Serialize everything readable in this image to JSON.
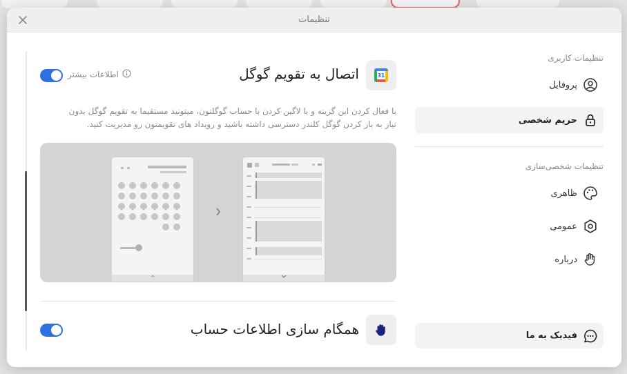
{
  "modal": {
    "title": "تنظیمات"
  },
  "sidebar": {
    "user_settings_title": "تنظیمات کاربری",
    "items": [
      {
        "label": "پروفایل",
        "icon": "user-circle-icon"
      },
      {
        "label": "حریم شخصی",
        "icon": "lock-icon",
        "active": true
      }
    ],
    "personalization_title": "تنظیمات شخصی‌سازی",
    "personal_items": [
      {
        "label": "ظاهری",
        "icon": "palette-icon"
      },
      {
        "label": "عمومی",
        "icon": "gear-hexagon-icon"
      },
      {
        "label": "درباره",
        "icon": "hand-wave-icon"
      }
    ],
    "feedback_label": "فیدبک به ما"
  },
  "google_calendar": {
    "title": "اتصال به تقویم گوگل",
    "icon_label": "31",
    "more_info": "اطلاعات بیشتر",
    "enabled": true,
    "description_line1": "با فعال کردن این گزینه و با لاگین کردن با حساب گوگلتون، میتونید مستقیما به تقویم گوگل بدون",
    "description_line2": "نیاز به باز کردن گوگل کلندر دسترسی داشته باشید و رویداد های تقویمتون رو مدیریت کنید."
  },
  "account_sync": {
    "title": "همگام سازی اطلاعات حساب",
    "enabled": true
  },
  "colors": {
    "toggle_on": "#2f6fe0",
    "active_item_bg": "#f3f3f3",
    "illustration_bg": "#d4d4d4"
  }
}
